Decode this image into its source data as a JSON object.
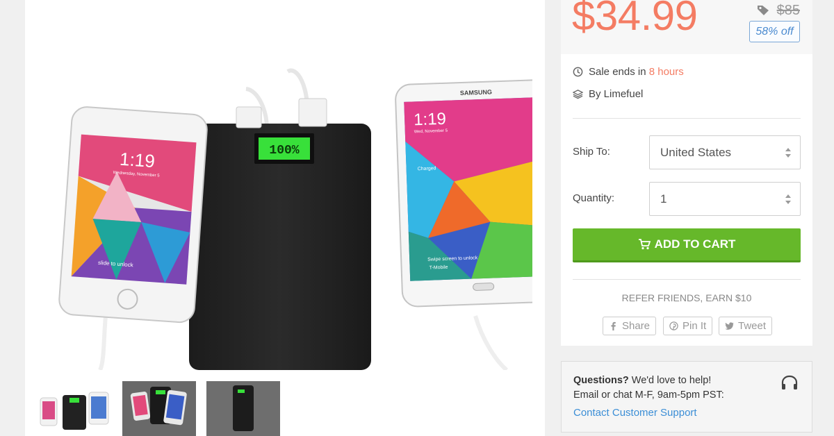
{
  "product": {
    "price": "$34.99",
    "original_price": "$85",
    "discount": "58% off",
    "sale_prefix": "Sale ends in ",
    "sale_remaining": "8 hours",
    "vendor": "By Limefuel",
    "icons": {
      "tag": "tag-icon",
      "clock": "clock-icon",
      "vendor": "layers-icon"
    }
  },
  "form": {
    "ship_label": "Ship To:",
    "ship_value": "United States",
    "quantity_label": "Quantity:",
    "quantity_value": "1"
  },
  "cart": {
    "label": "ADD TO CART",
    "icon": "cart-icon",
    "color": "#66b82a"
  },
  "refer": {
    "text": "REFER FRIENDS, EARN $10"
  },
  "share": [
    {
      "label": "Share",
      "icon": "facebook-icon"
    },
    {
      "label": "Pin It",
      "icon": "pinterest-icon"
    },
    {
      "label": "Tweet",
      "icon": "twitter-icon"
    }
  ],
  "help": {
    "question": "Questions?",
    "question_rest": " We'd love to help!",
    "hours": "Email or chat M-F, 9am-5pm PST:",
    "link": "Contact Customer Support",
    "icon": "headset-icon"
  },
  "gallery": {
    "phone_left": {
      "time": "1:19",
      "date": "Wednesday, November 5",
      "unlock": "slide to unlock"
    },
    "phone_right": {
      "brand": "SAMSUNG",
      "time": "1:19",
      "date": "Wed, November 5",
      "status": "Charged",
      "swipe": "Swipe screen to unlock",
      "carrier": "T-Mobile"
    },
    "powerbank_display": "100%",
    "thumbnails": 3
  },
  "colors": {
    "price": "#f47c63",
    "accent": "#3b8ed6",
    "cart": "#66b82a"
  }
}
